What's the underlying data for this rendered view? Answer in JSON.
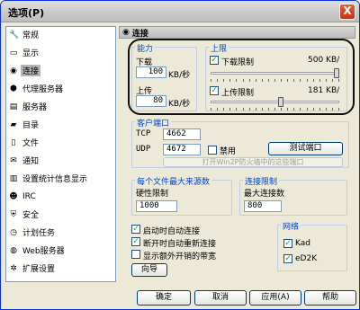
{
  "window": {
    "title": "选项(P)",
    "close_label": "X"
  },
  "sidebar": {
    "items": [
      {
        "label": "常规",
        "icon": "wrench-icon",
        "glyph": "🔧",
        "selected": false
      },
      {
        "label": "显示",
        "icon": "display-icon",
        "glyph": "▭",
        "selected": false
      },
      {
        "label": "连接",
        "icon": "connection-icon",
        "glyph": "◉",
        "selected": true
      },
      {
        "label": "代理服务器",
        "icon": "proxy-icon",
        "glyph": "⬢",
        "selected": false
      },
      {
        "label": "服务器",
        "icon": "server-icon",
        "glyph": "▤",
        "selected": false
      },
      {
        "label": "目录",
        "icon": "folder-icon",
        "glyph": "▰",
        "selected": false
      },
      {
        "label": "文件",
        "icon": "file-icon",
        "glyph": "▯",
        "selected": false
      },
      {
        "label": "通知",
        "icon": "notification-icon",
        "glyph": "✉",
        "selected": false
      },
      {
        "label": "设置统计信息显示",
        "icon": "stats-icon",
        "glyph": "▥",
        "selected": false
      },
      {
        "label": "IRC",
        "icon": "irc-icon",
        "glyph": "☻",
        "selected": false
      },
      {
        "label": "安全",
        "icon": "shield-icon",
        "glyph": "⛨",
        "selected": false
      },
      {
        "label": "计划任务",
        "icon": "clock-icon",
        "glyph": "◷",
        "selected": false
      },
      {
        "label": "Web服务器",
        "icon": "globe-icon",
        "glyph": "◍",
        "selected": false
      },
      {
        "label": "扩展设置",
        "icon": "gear-icon",
        "glyph": "✲",
        "selected": false
      }
    ]
  },
  "panel": {
    "header_icon": "connection-icon",
    "header_glyph": "◉",
    "title": "连接",
    "capacity": {
      "title": "能力",
      "download_label": "下载",
      "download_value": "100",
      "upload_label": "上传",
      "upload_value": "80",
      "unit": "KB/秒"
    },
    "limits": {
      "title": "上限",
      "download_limit_label": "下载限制",
      "download_limit_checked": true,
      "download_limit_value": "500 KB/",
      "download_slider_level": 1.0,
      "upload_limit_label": "上传限制",
      "upload_limit_checked": true,
      "upload_limit_value": "181 KB/",
      "upload_slider_level": 0.55
    },
    "client_port": {
      "title": "客户端口",
      "tcp_label": "TCP",
      "tcp_value": "4662",
      "udp_label": "UDP",
      "udp_value": "4672",
      "disable_label": "禁用",
      "disable_checked": false,
      "test_button": "测试端口",
      "firewall_button": "打开Win2P防火墙中的这些端口"
    },
    "max_sources": {
      "title": "每个文件最大来源数",
      "hard_limit_label": "硬性限制",
      "hard_limit_value": "1000"
    },
    "connection_limit": {
      "title": "连接限制",
      "max_connections_label": "最大连接数",
      "max_connections_value": "800"
    },
    "options": {
      "autoconnect_label": "启动时自动连接",
      "autoconnect_checked": true,
      "reconnect_label": "断开时自动重新连接",
      "reconnect_checked": true,
      "overhead_label": "显示额外开销的带宽",
      "overhead_checked": false,
      "wizard_button": "向导"
    },
    "network": {
      "title": "网络",
      "kad_label": "Kad",
      "kad_checked": true,
      "ed2k_label": "eD2K",
      "ed2k_checked": true
    }
  },
  "footer": {
    "ok": "确定",
    "cancel": "取消",
    "apply": "应用(A)",
    "help": "帮助"
  }
}
